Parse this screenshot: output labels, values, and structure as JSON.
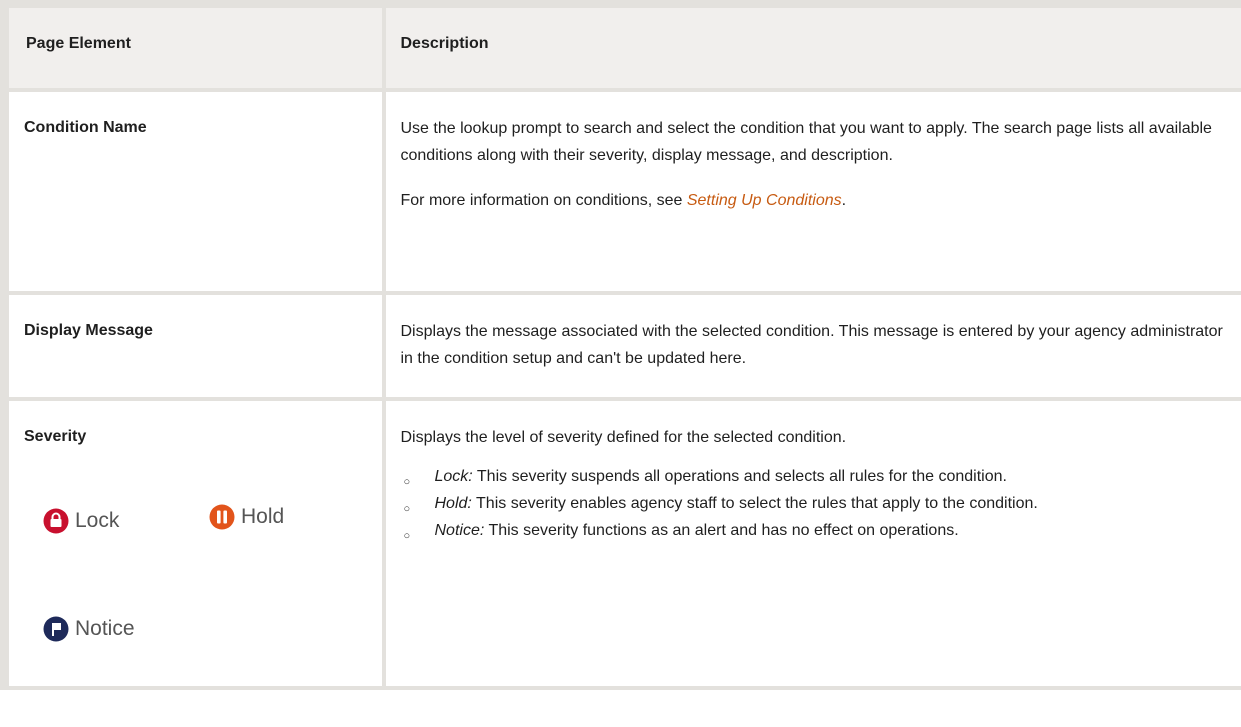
{
  "table": {
    "headers": [
      "Page Element",
      "Description"
    ],
    "rows": [
      {
        "element": "Condition Name",
        "paragraphs": [
          "Use the lookup prompt to search and select the condition that you want to apply. The search page lists all available conditions along with their severity, display message, and description."
        ],
        "more_info_prefix": "For more information on conditions, see ",
        "more_info_link": "Setting Up Conditions",
        "more_info_suffix": "."
      },
      {
        "element": "Display Message",
        "paragraphs": [
          "Displays the message associated with the selected condition. This message is entered by your agency administrator in the condition setup and can't be updated here."
        ]
      },
      {
        "element": "Severity",
        "intro": "Displays the level of severity defined for the selected condition.",
        "icons": [
          {
            "label": "Lock",
            "icon": "lock-icon",
            "color": "#c8102e"
          },
          {
            "label": "Hold",
            "icon": "hold-pause-icon",
            "color": "#e2541b"
          },
          {
            "label": "Notice",
            "icon": "notice-flag-icon",
            "color": "#1e2a5a"
          }
        ],
        "bullets": [
          {
            "term": "Lock:",
            "text": " This severity suspends all operations and selects all rules for the condition."
          },
          {
            "term": "Hold:",
            "text": " This severity enables agency staff to select the rules that apply to the condition."
          },
          {
            "term": "Notice:",
            "text": " This severity functions as an alert and has no effect on operations."
          }
        ]
      }
    ]
  }
}
